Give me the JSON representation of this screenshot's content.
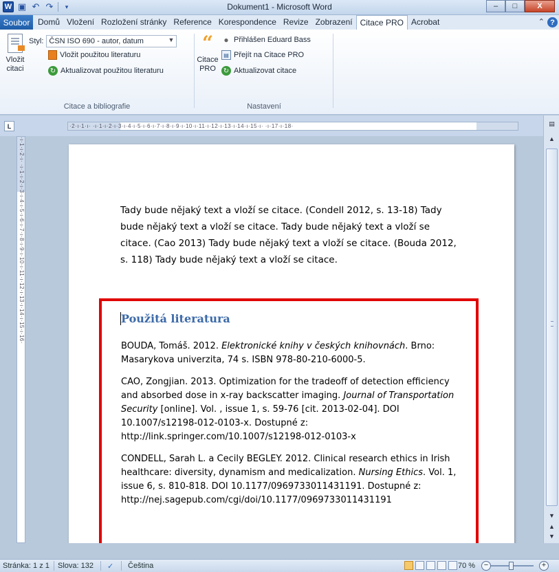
{
  "window": {
    "title": "Dokument1 - Microsoft Word",
    "app_logo": "W",
    "minimize": "–",
    "maximize": "□",
    "close": "X"
  },
  "qat": {
    "save_icon": "floppy-icon",
    "undo_icon": "undo-icon",
    "redo_icon": "redo-icon"
  },
  "tabs": {
    "file": "Soubor",
    "items": [
      "Domů",
      "Vložení",
      "Rozložení stránky",
      "Reference",
      "Korespondence",
      "Revize",
      "Zobrazení",
      "Citace PRO",
      "Acrobat"
    ],
    "active": "Citace PRO"
  },
  "ribbon": {
    "group1": {
      "label": "Citace a bibliografie",
      "insert_citation": "Vložit citaci",
      "insert_citation_l1": "Vložit",
      "insert_citation_l2": "citaci",
      "style_label": "Styl:",
      "style_value": "ČSN ISO 690 - autor, datum",
      "insert_bibliography": "Vložit použitou literaturu",
      "update_bibliography": "Aktualizovat použitou literaturu"
    },
    "group2": {
      "label": "Nastavení",
      "citace_pro_l1": "Citace",
      "citace_pro_l2": "PRO",
      "logged_in": "Přihlášen Eduard Bass",
      "go_to": "Přejít na Citace PRO",
      "update_citations": "Aktualizovat citace"
    }
  },
  "ruler": {
    "tab_selector": "L",
    "h_marks": "·2·ı·1·ı·  ·ı·1·ı·2·ı·3·ı·4·ı·5·ı·6·ı·7·ı·8·ı·9·ı·10·ı·11·ı·12·ı·13·ı·14·ı·15·ı·  ·ı·17·ı·18·",
    "v_marks": "·ı·1·ı·2·ı·  ·ı·1·ı·2·ı·3·ı·4·ı·5·ı·6·ı·7·ı·8·ı·9·ı·10·ı·11·ı·12·ı·13·ı·14·ı·15·ı·16·"
  },
  "document": {
    "body": "Tady bude nějaký text a vloží se citace. (Condell 2012, s. 13-18) Tady bude nějaký text a vloží se citace. Tady bude nějaký text a vloží se citace. (Cao 2013) Tady bude nějaký text a vloží se citace. (Bouda 2012, s. 118) Tady bude nějaký text a vloží se citace.",
    "bib_title": "Použitá literatura",
    "entries": [
      {
        "pre": "BOUDA, Tomáš. 2012. ",
        "italic": "Elektronické knihy v českých knihovnách",
        "post": ". Brno: Masarykova univerzita, 74 s. ISBN 978-80-210-6000-5."
      },
      {
        "pre": "CAO, Zongjian. 2013. Optimization for the tradeoff of detection efficiency and absorbed dose in x-ray backscatter imaging. ",
        "italic": "Journal of Transportation Security",
        "post": " [online]. Vol. , issue 1, s. 59-76 [cit. 2013-02-04]. DOI 10.1007/s12198-012-0103-x. Dostupné z: http://link.springer.com/10.1007/s12198-012-0103-x"
      },
      {
        "pre": "CONDELL, Sarah L. a Cecily BEGLEY. 2012. Clinical research ethics in Irish healthcare: diversity, dynamism and medicalization. ",
        "italic": "Nursing Ethics",
        "post": ". Vol. 1, issue 6, s. 810-818. DOI 10.1177/0969733011431191. Dostupné z: http://nej.sagepub.com/cgi/doi/10.1177/0969733011431191"
      }
    ]
  },
  "status": {
    "page": "Stránka: 1 z 1",
    "words": "Slova: 132",
    "language": "Čeština",
    "zoom": "70 %",
    "zoom_out": "−",
    "zoom_in": "+"
  },
  "colors": {
    "accent": "#1f5da8",
    "highlight_box": "#e00000",
    "heading": "#3c6aa8"
  }
}
